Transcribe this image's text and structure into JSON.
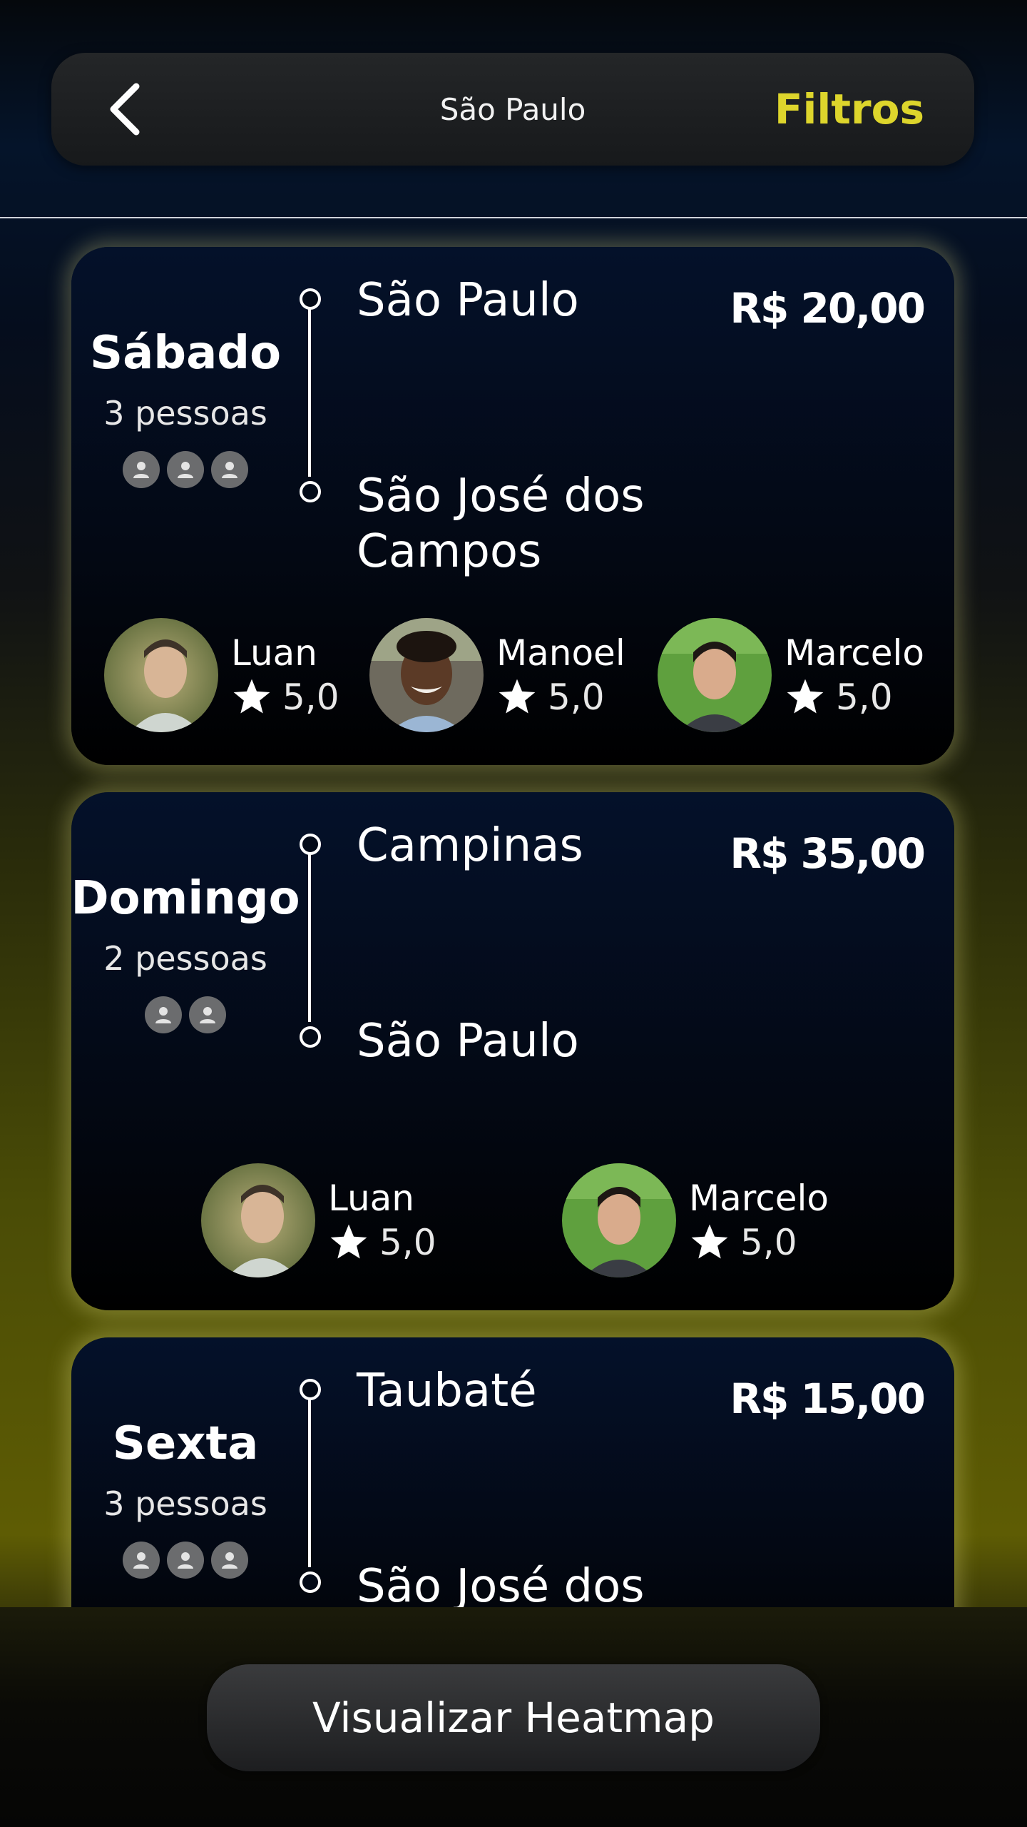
{
  "header": {
    "title": "São Paulo",
    "filters_label": "Filtros",
    "accent_color": "#ddd52c"
  },
  "rides": [
    {
      "day": "Sábado",
      "people": "3 pessoas",
      "seats_count": 3,
      "origin": "São Paulo",
      "destination": "São José dos Campos",
      "price": "R$ 20,00",
      "drivers": [
        {
          "name": "Luan",
          "rating": "5,0"
        },
        {
          "name": "Manoel",
          "rating": "5,0"
        },
        {
          "name": "Marcelo",
          "rating": "5,0"
        }
      ]
    },
    {
      "day": "Domingo",
      "people": "2 pessoas",
      "seats_count": 2,
      "origin": "Campinas",
      "destination": "São Paulo",
      "price": "R$ 35,00",
      "drivers": [
        {
          "name": "Luan",
          "rating": "5,0"
        },
        {
          "name": "Marcelo",
          "rating": "5,0"
        }
      ]
    },
    {
      "day": "Sexta",
      "people": "3 pessoas",
      "seats_count": 3,
      "origin": "Taubaté",
      "destination": "São José dos",
      "price": "R$ 15,00",
      "drivers": []
    }
  ],
  "footer": {
    "heatmap_label": "Visualizar Heatmap"
  }
}
